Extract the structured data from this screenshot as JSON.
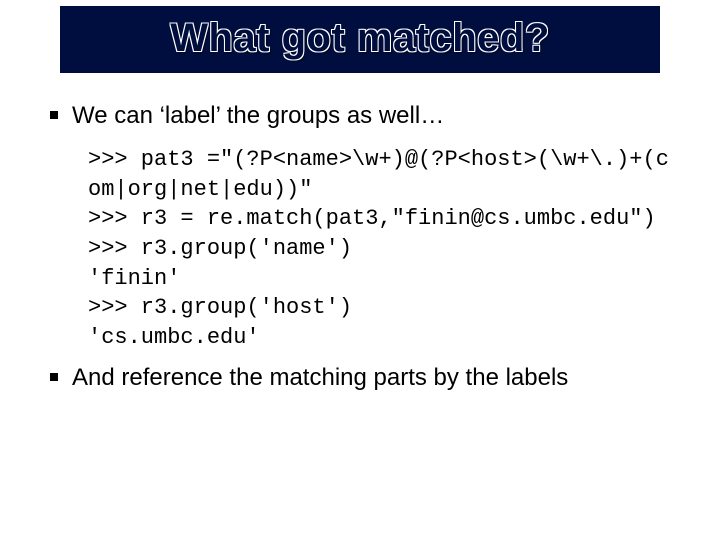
{
  "title": "What got matched?",
  "bullets": {
    "intro": "We can ‘label’ the groups as well…",
    "outro": "And reference the matching parts by the labels"
  },
  "code": ">>> pat3 =\"(?P<name>\\w+)@(?P<host>(\\w+\\.)+(com|org|net|edu))\"\n>>> r3 = re.match(pat3,\"finin@cs.umbc.edu\")\n>>> r3.group('name')\n'finin'\n>>> r3.group('host')\n'cs.umbc.edu'"
}
